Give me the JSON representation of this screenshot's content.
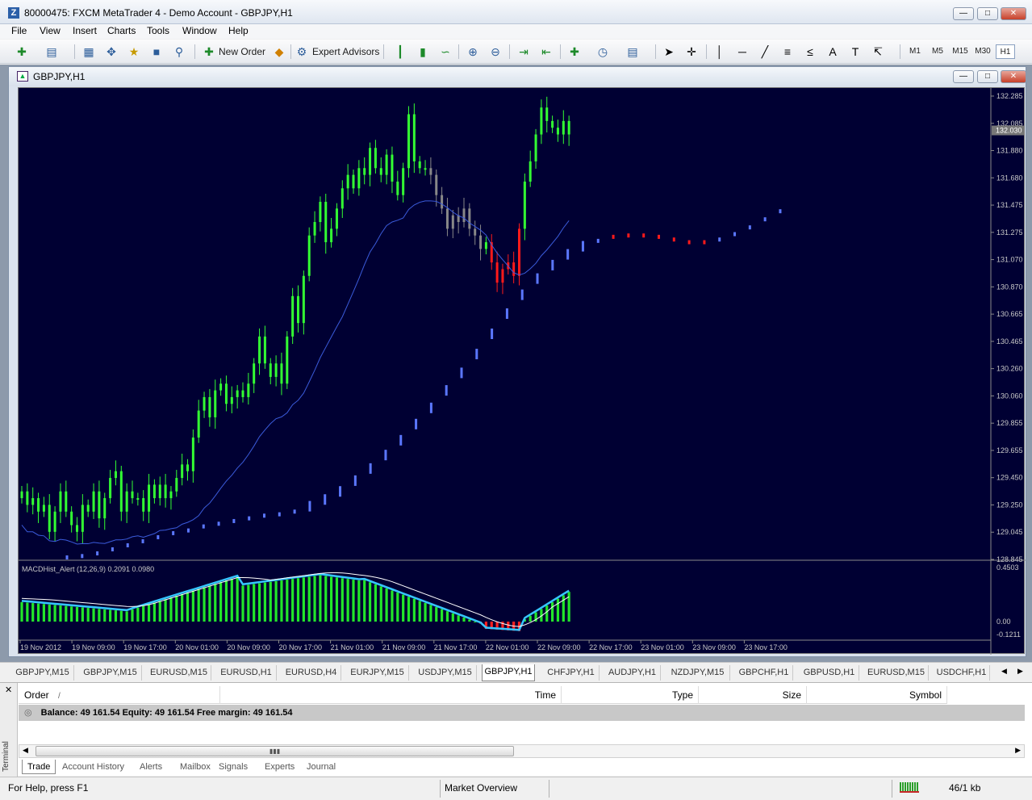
{
  "window": {
    "title": "80000475: FXCM MetaTrader 4 - Demo Account - GBPJPY,H1"
  },
  "menu": [
    "File",
    "View",
    "Insert",
    "Charts",
    "Tools",
    "Window",
    "Help"
  ],
  "toolbar": {
    "new_order": "New Order",
    "expert_advisors": "Expert Advisors",
    "timeframes": [
      "M1",
      "M5",
      "M15",
      "M30",
      "H1"
    ],
    "active_timeframe": "H1"
  },
  "chart_window": {
    "title": "GBPJPY,H1"
  },
  "indicator": {
    "label": "MACDHist_Alert (12,26,9)  0.2091  0.0980"
  },
  "chart_data": {
    "type": "candlestick",
    "symbol": "GBPJPY",
    "timeframe": "H1",
    "current_price": "132.030",
    "price_axis_ticks": [
      "132.285",
      "132.085",
      "131.880",
      "131.680",
      "131.475",
      "131.275",
      "131.070",
      "130.870",
      "130.665",
      "130.465",
      "130.260",
      "130.060",
      "129.855",
      "129.655",
      "129.450",
      "129.250",
      "129.045",
      "128.845"
    ],
    "macd_axis_ticks": [
      "0.4503",
      "0.00",
      "-0.1211"
    ],
    "time_axis_ticks": [
      "19 Nov 2012",
      "19 Nov 09:00",
      "19 Nov 17:00",
      "20 Nov 01:00",
      "20 Nov 09:00",
      "20 Nov 17:00",
      "21 Nov 01:00",
      "21 Nov 09:00",
      "21 Nov 17:00",
      "22 Nov 01:00",
      "22 Nov 09:00",
      "22 Nov 17:00",
      "23 Nov 01:00",
      "23 Nov 09:00",
      "23 Nov 17:00"
    ],
    "ylim": [
      128.845,
      132.285
    ],
    "colors": {
      "background": "#000033",
      "bull": "#33ff33",
      "bear": "#33ff33",
      "neutral": "#888888",
      "down_signal": "#ff1a1a",
      "ma_line": "#3b5bdb",
      "ma_dots": "#5b77ff",
      "macd_hist_up": "#22e62a",
      "macd_hist_down": "#ff2020",
      "macd_signal": "#36c6ff",
      "macd_line": "#ffffff"
    },
    "closes": [
      129.35,
      129.25,
      129.3,
      129.2,
      129.25,
      129.05,
      129.2,
      129.35,
      129.2,
      129.1,
      129.05,
      129.25,
      129.2,
      129.35,
      129.15,
      129.3,
      129.45,
      129.5,
      129.2,
      129.35,
      129.3,
      129.3,
      129.2,
      129.4,
      129.3,
      129.4,
      129.3,
      129.35,
      129.45,
      129.55,
      129.5,
      129.75,
      129.95,
      130.05,
      129.9,
      130.1,
      130.15,
      130.0,
      130.05,
      130.1,
      130.05,
      130.15,
      130.3,
      130.5,
      130.3,
      130.2,
      130.3,
      130.15,
      130.5,
      130.8,
      130.6,
      130.95,
      131.25,
      131.35,
      131.5,
      131.2,
      131.3,
      131.45,
      131.6,
      131.7,
      131.6,
      131.75,
      131.7,
      131.9,
      131.75,
      131.7,
      131.85,
      131.65,
      131.55,
      131.75,
      132.15,
      131.8,
      131.75,
      131.75,
      131.7,
      131.55,
      131.45,
      131.3,
      131.4,
      131.35,
      131.45,
      131.3,
      131.25,
      131.15,
      131.2,
      131.05,
      130.9,
      131.0,
      131.05,
      130.95,
      131.3,
      131.65,
      131.8,
      132.0,
      132.2,
      132.1,
      132.05,
      132.0,
      132.1,
      132.0
    ],
    "ma_dots": [
      128.86,
      128.87,
      128.89,
      128.92,
      128.95,
      128.98,
      129.01,
      129.04,
      129.06,
      129.09,
      129.11,
      129.13,
      129.15,
      129.17,
      129.18,
      129.2,
      129.24,
      129.29,
      129.35,
      129.43,
      129.52,
      129.62,
      129.73,
      129.85,
      129.97,
      130.1,
      130.23,
      130.37,
      130.52,
      130.67,
      130.81,
      130.93,
      131.03,
      131.11,
      131.17,
      131.21,
      131.24,
      131.25,
      131.25,
      131.24,
      131.22,
      131.2,
      131.2,
      131.22,
      131.26,
      131.31,
      131.37,
      131.43
    ]
  },
  "symbol_tabs": [
    "GBPJPY,M15",
    "GBPJPY,M15",
    "EURUSD,M15",
    "EURUSD,H1",
    "EURUSD,H4",
    "EURJPY,M15",
    "USDJPY,M15",
    "GBPJPY,H1",
    "CHFJPY,H1",
    "AUDJPY,H1",
    "NZDJPY,M15",
    "GBPCHF,H1",
    "GBPUSD,H1",
    "EURUSD,M15",
    "USDCHF,H1"
  ],
  "active_symbol_tab": "GBPJPY,H1",
  "terminal": {
    "side_label": "Terminal",
    "columns": {
      "order": "Order",
      "sort_marker": "/",
      "time": "Time",
      "type": "Type",
      "size": "Size",
      "symbol": "Symbol"
    },
    "balance_line": "Balance: 49 161.54  Equity: 49 161.54  Free margin: 49 161.54",
    "tabs": [
      "Trade",
      "Account History",
      "Alerts",
      "Mailbox",
      "Signals",
      "Experts",
      "Journal"
    ],
    "active_tab": "Trade"
  },
  "status": {
    "help": "For Help, press F1",
    "profile": "Market Overview",
    "traffic": "46/1 kb"
  }
}
